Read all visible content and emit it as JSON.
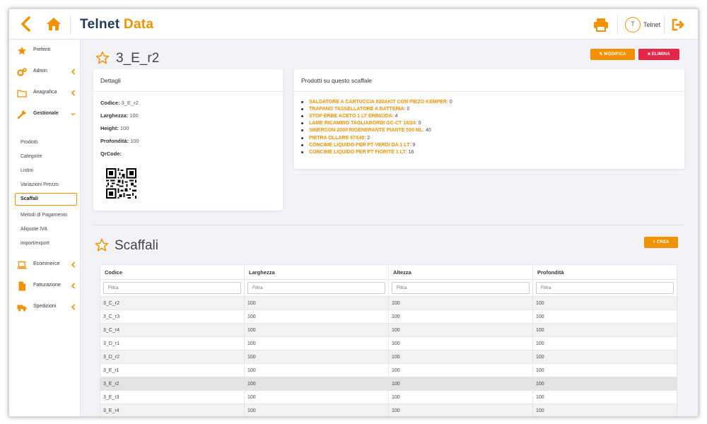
{
  "header": {
    "logo_part1": "Telnet ",
    "logo_part2": "Data",
    "user_initial": "T",
    "user_name": "Telnet",
    "back_icon": "chevron-left-icon",
    "home_icon": "home-icon",
    "print_icon": "printer-icon",
    "logout_icon": "logout-icon"
  },
  "colors": {
    "accent": "#f39200",
    "danger": "#e5264b",
    "brand_dark": "#1f3a5c"
  },
  "sidebar": {
    "preferiti": "Preferiti",
    "admin": "Admin",
    "anagrafica": "Anagrafica",
    "gestionale": "Gestionale",
    "sub": [
      "Prodotti",
      "Categorie",
      "Listini",
      "Variazioni Prezzo",
      "Scaffali",
      "Metodi di Pagamento",
      "Aliquote IVA",
      "import/export"
    ],
    "ecommerce": "Ecommerce",
    "fatturazione": "Fatturazione",
    "spedizioni": "Spedizioni"
  },
  "detail": {
    "title": "3_E_r2",
    "modifica": "MODIFICA",
    "elimina": "ELIMINA",
    "card_title": "Dettagli",
    "codice_label": "Codice:",
    "codice_value": "3_E_r2",
    "larghezza_label": "Larghezza:",
    "larghezza_value": "100",
    "height_label": "Height:",
    "height_value": "100",
    "profondita_label": "Profondità:",
    "profondita_value": "100",
    "qrcode_label": "QrCode:"
  },
  "products": {
    "title": "Prodotti su questo scaffale",
    "items": [
      {
        "name": "SALDATORE A CARTUCCIA 820AKIT CON PIEZO KEMPER",
        "qty": "0"
      },
      {
        "name": "TRAPANO TASSELLATORE A BATTERIA",
        "qty": "0"
      },
      {
        "name": "STOP ERBE ACETO 1 LT ERBICIDA",
        "qty": "4"
      },
      {
        "name": "LAME RICAMBIO TAGLIABORDI GC-CT 18/24",
        "qty": "0"
      },
      {
        "name": "SINERGON 2000 RIGENERANTE PIANTE 500 ML",
        "qty": "40"
      },
      {
        "name": "PIETRA OLLARE 67X40",
        "qty": "2"
      },
      {
        "name": "CONCIME LIQUIDO PER PT VERDI DA 1 LT",
        "qty": "9"
      },
      {
        "name": "CONCIME LIQUIDO PER PT FIORITE 1 LT",
        "qty": "16"
      }
    ]
  },
  "list": {
    "title": "Scaffali",
    "crea": "CREA",
    "columns": [
      "Codice",
      "Larghezza",
      "Altezza",
      "Profondità"
    ],
    "filter_placeholder": "Filtra",
    "rows": [
      [
        "3_C_r2",
        "100",
        "100",
        "100"
      ],
      [
        "3_C_r3",
        "100",
        "100",
        "100"
      ],
      [
        "3_C_r4",
        "100",
        "100",
        "100"
      ],
      [
        "3_D_r1",
        "100",
        "100",
        "100"
      ],
      [
        "3_D_r2",
        "100",
        "100",
        "100"
      ],
      [
        "3_E_r1",
        "100",
        "100",
        "100"
      ],
      [
        "3_E_r2",
        "100",
        "100",
        "100"
      ],
      [
        "3_E_r3",
        "100",
        "100",
        "100"
      ],
      [
        "3_E_r4",
        "100",
        "100",
        "100"
      ]
    ]
  }
}
